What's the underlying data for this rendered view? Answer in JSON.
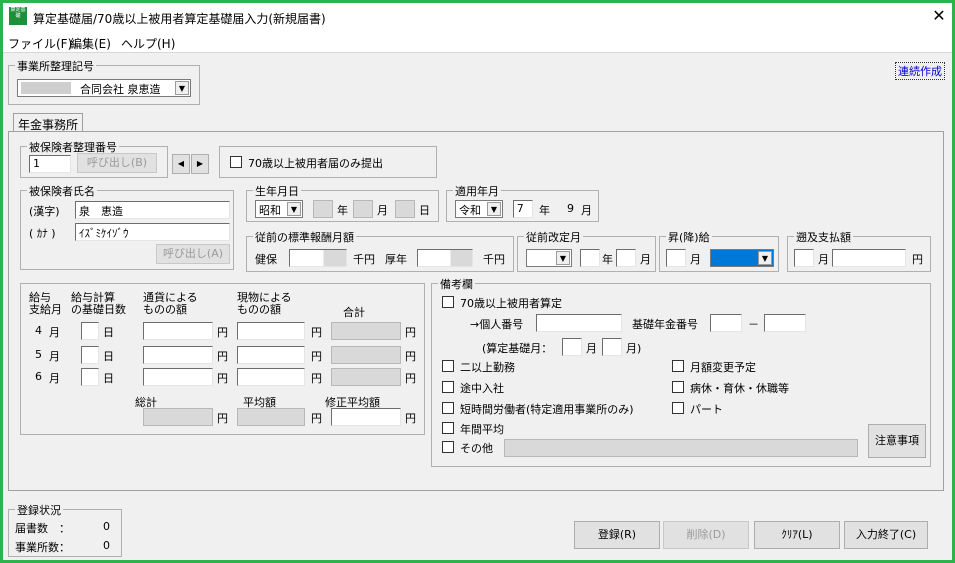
{
  "window": {
    "title": "算定基礎届/70歳以上被用者算定基礎届入力(新規届書)",
    "app_icon_text": "算定基礎"
  },
  "menu": [
    "ファイル(F)",
    "編集(E)",
    "ヘルプ(H)"
  ],
  "office": {
    "group_title": "事業所整理記号",
    "selected": "合同会社 泉恵造"
  },
  "continuous_link": "連続作成",
  "tab_label": "年金事務所",
  "insured_no": {
    "group_title": "被保険者整理番号",
    "value": "1",
    "call_button": "呼び出し(B)",
    "prev_glyph": "◀",
    "next_glyph": "▶"
  },
  "only70": {
    "label": "70歳以上被用者届のみ提出"
  },
  "name": {
    "group_title": "被保険者氏名",
    "kanji_label": "(漢字)",
    "kanji_value": "泉　恵造",
    "kana_label": "( ｶﾅ )",
    "kana_value": "ｲｽﾞﾐｹｲｿﾞｳ",
    "call_button": "呼び出し(A)"
  },
  "birth": {
    "group_title": "生年月日",
    "era": "昭和",
    "year_unit": "年",
    "month_unit": "月",
    "day_unit": "日"
  },
  "applicable": {
    "group_title": "適用年月",
    "era": "令和",
    "year": "7",
    "year_unit": "年",
    "month": "9",
    "month_unit": "月"
  },
  "prev_salary": {
    "group_title": "従前の標準報酬月額",
    "kenpo_label": "健保",
    "kousei_label": "厚年",
    "unit": "千円"
  },
  "prev_revision": {
    "group_title": "従前改定月",
    "year_unit": "年",
    "month_unit": "月"
  },
  "raise": {
    "group_title": "昇(降)給",
    "month_unit": "月"
  },
  "retro": {
    "group_title": "遡及支払額",
    "month_unit": "月",
    "yen_unit": "円"
  },
  "salary": {
    "headers": {
      "pay_month": "給与\n支給月",
      "base_days": "給与計算\nの基礎日数",
      "currency": "通貨による\nものの額",
      "goods": "現物による\nものの額",
      "total": "合計"
    },
    "rows": [
      {
        "month": "4",
        "month_unit": "月",
        "day_unit": "日",
        "yen": "円"
      },
      {
        "month": "5",
        "month_unit": "月",
        "day_unit": "日",
        "yen": "円"
      },
      {
        "month": "6",
        "month_unit": "月",
        "day_unit": "日",
        "yen": "円"
      }
    ],
    "grand_total_label": "総計",
    "average_label": "平均額",
    "adjusted_average_label": "修正平均額",
    "yen": "円"
  },
  "remarks": {
    "group_title": "備考欄",
    "over70_calc": "70歳以上被用者算定",
    "personal_no_label": "→個人番号",
    "pension_no_label": "基礎年金番号",
    "dash": "－",
    "calc_month_label": "(算定基礎月：",
    "month_unit": "月",
    "month_close": "月)",
    "left_items": [
      "二以上勤務",
      "途中入社",
      "短時間労働者(特定適用事業所のみ)",
      "年間平均",
      "その他"
    ],
    "right_items": [
      "月額変更予定",
      "病休・育休・休職等",
      "パート"
    ],
    "notes_button": "注意事項"
  },
  "status": {
    "group_title": "登録状況",
    "forms_label": "届書数　：",
    "forms_count": "0",
    "offices_label": "事業所数：",
    "offices_count": "0"
  },
  "buttons": {
    "register": "登録(R)",
    "delete": "削除(D)",
    "clear": "ｸﾘｱ(L)",
    "finish": "入力終了(C)"
  }
}
